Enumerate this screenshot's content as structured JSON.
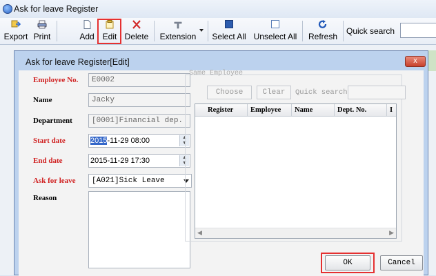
{
  "window": {
    "title": "Ask for leave Register"
  },
  "toolbar": {
    "export": "Export",
    "print": "Print",
    "add": "Add",
    "edit": "Edit",
    "delete": "Delete",
    "extension": "Extension",
    "select_all": "Select All",
    "unselect_all": "Unselect All",
    "refresh": "Refresh",
    "quick_search": "Quick search"
  },
  "dialog": {
    "title": "Ask for leave Register[Edit]",
    "close": "x",
    "fields": {
      "employee_no": {
        "label": "Employee No.",
        "value": "E0002"
      },
      "name": {
        "label": "Name",
        "value": "Jacky"
      },
      "department": {
        "label": "Department",
        "value": "[0001]Financial dep."
      },
      "start_date": {
        "label": "Start date",
        "value_selected": "2015",
        "value_rest": "-11-29 08:00"
      },
      "end_date": {
        "label": "End date",
        "value": "2015-11-29 17:30"
      },
      "ask_for_leave": {
        "label": "Ask for leave",
        "value": "[A021]Sick Leave"
      },
      "reason": {
        "label": "Reason",
        "value": ""
      }
    },
    "same_employee": {
      "legend": "Same Employee",
      "choose": "Choose",
      "clear": "Clear",
      "quick_search": "Quick search",
      "columns": [
        "Register",
        "Employee",
        "Name",
        "Dept. No.",
        "I"
      ]
    },
    "ok": "OK",
    "cancel": "Cancel"
  },
  "colors": {
    "required_label": "#d02020",
    "highlight_box": "#e53030",
    "dialog_frame": "#bcd2ee"
  }
}
